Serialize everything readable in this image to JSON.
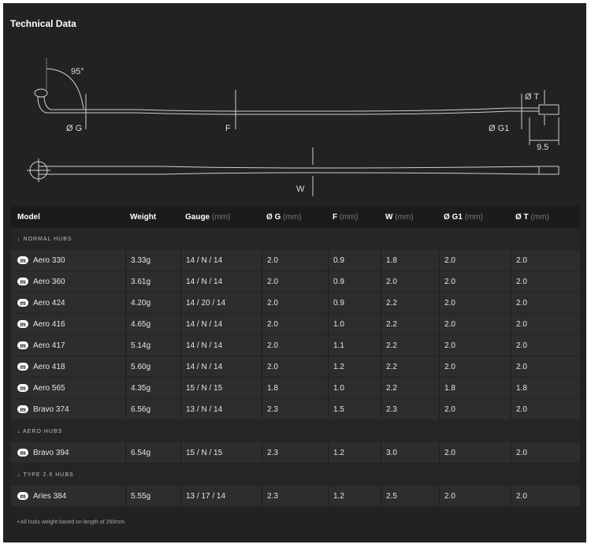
{
  "title": "Technical Data",
  "diagram": {
    "angle_label": "95°",
    "g_label": "Ø G",
    "f_label": "F",
    "g1_label": "Ø G1",
    "t_label": "Ø T",
    "end_length_label": "9.5",
    "w_label": "W"
  },
  "table": {
    "headers": [
      {
        "label": "Model",
        "unit": ""
      },
      {
        "label": "Weight",
        "unit": ""
      },
      {
        "label": "Gauge",
        "unit": "(mm)"
      },
      {
        "label": "Ø G",
        "unit": "(mm)"
      },
      {
        "label": "F",
        "unit": "(mm)"
      },
      {
        "label": "W",
        "unit": "(mm)"
      },
      {
        "label": "Ø G1",
        "unit": "(mm)"
      },
      {
        "label": "Ø T",
        "unit": "(mm)"
      }
    ],
    "brand_badge": "m",
    "sections": [
      {
        "label": "↓ NORMAL HUBS",
        "rows": [
          [
            "Aero 330",
            "3.33g",
            "14 / N / 14",
            "2.0",
            "0.9",
            "1.8",
            "2.0",
            "2.0"
          ],
          [
            "Aero 360",
            "3.61g",
            "14 / N / 14",
            "2.0",
            "0.9",
            "2.0",
            "2.0",
            "2.0"
          ],
          [
            "Aero 424",
            "4.20g",
            "14 / 20 / 14",
            "2.0",
            "0.9",
            "2.2",
            "2.0",
            "2.0"
          ],
          [
            "Aero 416",
            "4.65g",
            "14 / N / 14",
            "2.0",
            "1.0",
            "2.2",
            "2.0",
            "2.0"
          ],
          [
            "Aero 417",
            "5.14g",
            "14 / N / 14",
            "2.0",
            "1.1",
            "2.2",
            "2.0",
            "2.0"
          ],
          [
            "Aero 418",
            "5.60g",
            "14 / N / 14",
            "2.0",
            "1.2",
            "2.2",
            "2.0",
            "2.0"
          ],
          [
            "Aero 565",
            "4.35g",
            "15 / N / 15",
            "1.8",
            "1.0",
            "2.2",
            "1.8",
            "1.8"
          ],
          [
            "Bravo 374",
            "6.56g",
            "13 / N / 14",
            "2.3",
            "1.5",
            "2.3",
            "2.0",
            "2.0"
          ]
        ]
      },
      {
        "label": "↓ AERO HUBS",
        "rows": [
          [
            "Bravo 394",
            "6.54g",
            "15 / N / 15",
            "2.3",
            "1.2",
            "3.0",
            "2.0",
            "2.0"
          ]
        ]
      },
      {
        "label": "↓ TYPE 2.6 HUBS",
        "rows": [
          [
            "Aries 384",
            "5.55g",
            "13 / 17 / 14",
            "2.3",
            "1.2",
            "2.5",
            "2.0",
            "2.0"
          ]
        ]
      }
    ]
  },
  "footnote": "•  All hubs weight based on length of 260mm.",
  "colors": {
    "panel": "#222222",
    "header": "#1b1b1b",
    "row": "#2d2d2d",
    "text": "#e6e6e6"
  }
}
